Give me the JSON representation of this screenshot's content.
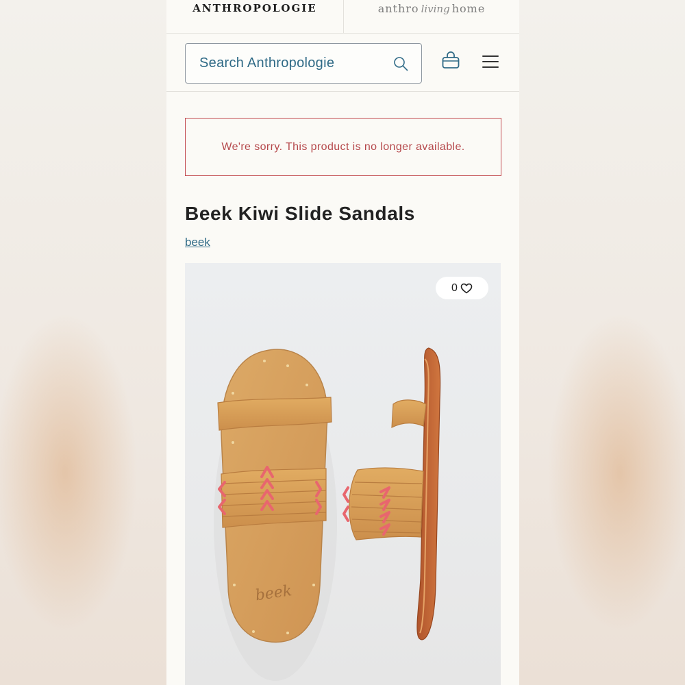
{
  "brands": {
    "primary": "ANTHROPOLOGIE",
    "secondary_left": "anthro",
    "secondary_script": "living",
    "secondary_right": "home"
  },
  "header": {
    "search_placeholder": "Search Anthropologie",
    "icons": [
      "search-icon",
      "shopping-bag-icon",
      "hamburger-menu-icon"
    ]
  },
  "alert": {
    "message": "We're sorry. This product is no longer available."
  },
  "product": {
    "title": "Beek Kiwi Slide Sandals",
    "brand_link": "beek",
    "favorites_count": "0",
    "image_logo_text": "beek"
  },
  "colors": {
    "accent_blue": "#2f6a86",
    "alert_red": "#c24a4e",
    "leather_tan": "#d9a25e",
    "lacing_pink": "#e8666e"
  }
}
